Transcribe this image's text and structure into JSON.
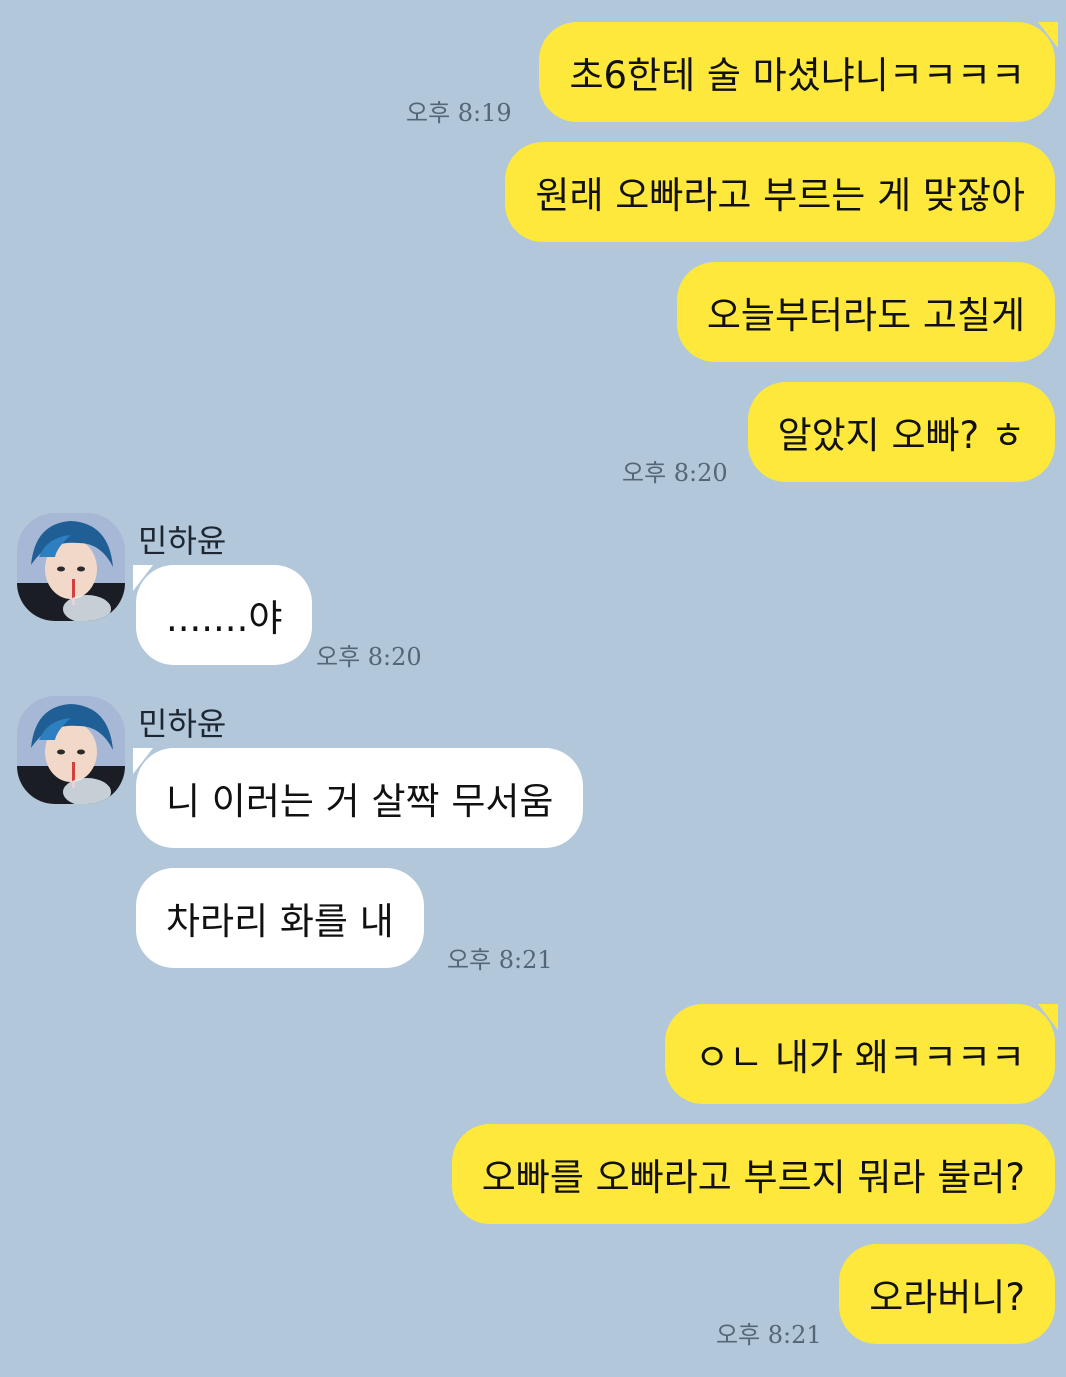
{
  "chat": {
    "colors": {
      "background": "#b2c7da",
      "my_bubble": "#fee83b",
      "their_bubble": "#ffffff"
    },
    "messages": [
      {
        "text": "초6한테 술 마셨냐니ㅋㅋㅋㅋ",
        "from": "me"
      },
      {
        "text": "원래 오빠라고 부르는 게 맞잖아",
        "from": "me"
      },
      {
        "text": "오늘부터라도 고칠게",
        "from": "me"
      },
      {
        "text": "알았지 오빠? ㅎ",
        "from": "me"
      },
      {
        "text": ".......야",
        "from": "them"
      },
      {
        "text": "니 이러는 거 살짝 무서움",
        "from": "them"
      },
      {
        "text": "차라리 화를 내",
        "from": "them"
      },
      {
        "text": "ㅇㄴ 내가 왜ㅋㅋㅋㅋ",
        "from": "me"
      },
      {
        "text": "오빠를 오빠라고 부르지 뭐라 불러?",
        "from": "me"
      },
      {
        "text": "오라버니?",
        "from": "me"
      }
    ],
    "timestamps": [
      "오후 8:19",
      "오후 8:20",
      "오후 8:20",
      "오후 8:21",
      "오후 8:21"
    ],
    "senders": [
      {
        "name": "민하윤",
        "avatar_icon": "profile-photo"
      },
      {
        "name": "민하윤",
        "avatar_icon": "profile-photo"
      }
    ]
  }
}
